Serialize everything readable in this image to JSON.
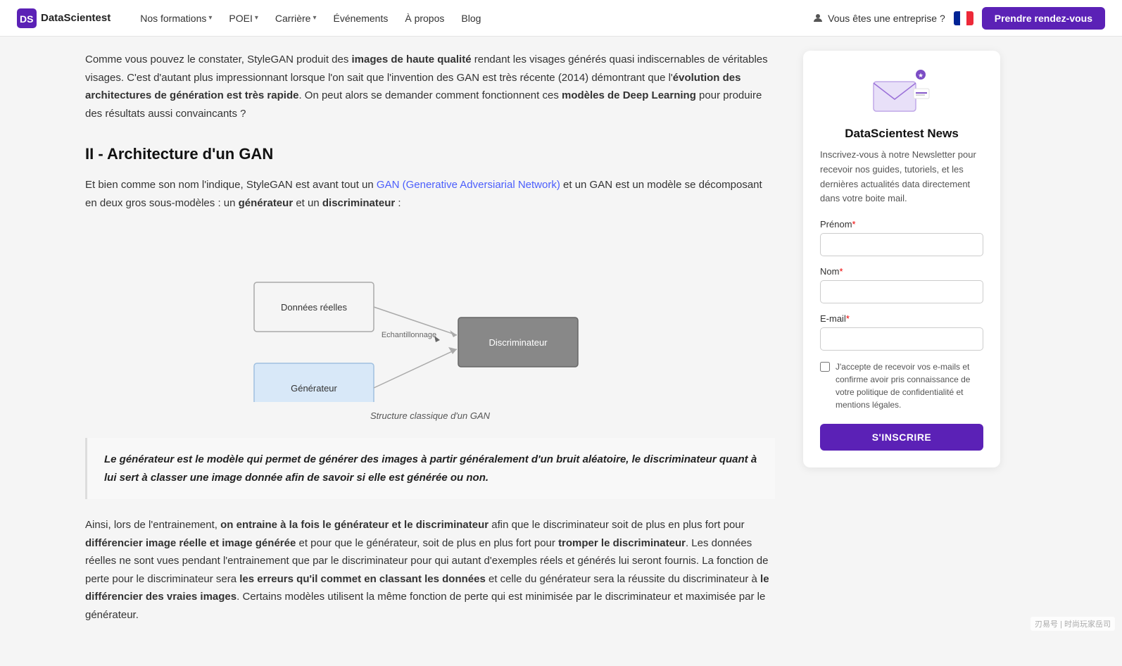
{
  "nav": {
    "logo_text": "DataScientest",
    "links": [
      {
        "label": "Nos formations",
        "has_dropdown": true
      },
      {
        "label": "POEI",
        "has_dropdown": true
      },
      {
        "label": "Carrière",
        "has_dropdown": true
      },
      {
        "label": "Événements",
        "has_dropdown": false
      },
      {
        "label": "À propos",
        "has_dropdown": false
      },
      {
        "label": "Blog",
        "has_dropdown": false
      }
    ],
    "enterprise_label": "Vous êtes une entreprise ?",
    "cta_label": "Prendre rendez-vous"
  },
  "article": {
    "para1": "Comme vous pouvez le constater, StyleGAN produit des ",
    "para1_bold1": "images de haute qualité",
    "para1_rest": " rendant les visages générés quasi indiscernables de véritables visages. C'est d'autant plus impressionnant lorsque l'on sait que l'invention des GAN est très récente (2014) démontrant que l'",
    "para1_bold2": "évolution des architectures de génération est très rapide",
    "para1_end": ". On peut alors se demander comment fonctionnent ces ",
    "para1_bold3": "modèles de Deep Learning",
    "para1_final": " pour produire des résultats aussi convaincants ?",
    "section2_title": "II - Architecture d'un GAN",
    "para2_start": "Et bien comme son nom l'indique, StyleGAN est avant tout un ",
    "para2_link": "GAN (Generative Adversiarial Network)",
    "para2_rest": " et un GAN est un modèle se décomposant en deux gros sous-modèles : un ",
    "para2_bold1": "générateur",
    "para2_mid": " et un ",
    "para2_bold2": "discriminateur",
    "para2_end": " :",
    "diagram_nodes": {
      "real_data": "Données réelles",
      "sampling": "Echantillonnage",
      "discriminator": "Discriminateur",
      "generator": "Générateur"
    },
    "diagram_caption": "Structure classique d'un GAN",
    "blockquote": "Le générateur est le modèle qui permet de générer des images à partir généralement d'un bruit aléatoire, le discriminateur quant à lui sert à classer une image donnée afin de savoir si elle est générée ou non.",
    "para3_start": "Ainsi, lors de l'entrainement, ",
    "para3_bold1": "on entraine à la fois le générateur et le discriminateur",
    "para3_rest": " afin que le discriminateur soit de plus en plus fort pour ",
    "para3_bold2": "différencier image réelle et image générée",
    "para3_mid": " et pour que le générateur, soit de plus en plus fort pour ",
    "para3_bold3": "tromper le discriminateur",
    "para3_cont": ". Les données réelles ne sont vues pendant l'entrainement que par le discriminateur pour qui autant d'exemples réels et générés lui seront fournis. La fonction de perte pour le discriminateur sera ",
    "para3_bold4": "les erreurs qu'il commet en classant les données",
    "para3_mid2": " et celle du générateur sera la réussite du discriminateur à ",
    "para3_bold5": "le différencier des vraies images",
    "para3_end": ". Certains modèles utilisent la même fonction de perte qui est minimisée par le discriminateur et maximisée par le générateur."
  },
  "sidebar": {
    "title": "DataScientest News",
    "desc": "Inscrivez-vous à notre Newsletter pour recevoir nos guides, tutoriels, et les dernières actualités data directement dans votre boite mail.",
    "form": {
      "prenom_label": "Prénom",
      "prenom_required": true,
      "nom_label": "Nom",
      "nom_required": true,
      "email_label": "E-mail",
      "email_required": true,
      "checkbox_label": "J'accepte de recevoir vos e-mails et confirme avoir pris connaissance de votre politique de confidentialité et mentions légales.",
      "submit_label": "S'INSCRIRE"
    }
  },
  "watermark": "刃易号 | 时尚玩家岳司"
}
